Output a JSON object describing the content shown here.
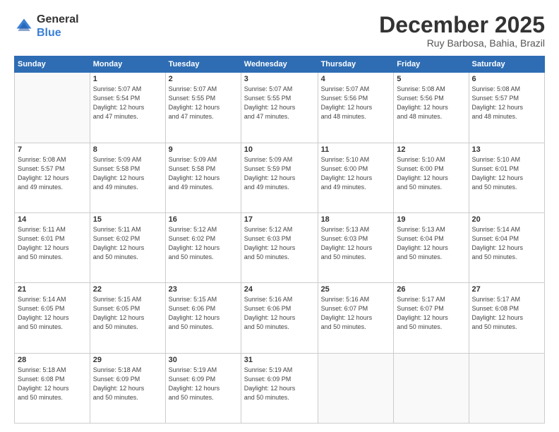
{
  "header": {
    "logo_line1": "General",
    "logo_line2": "Blue",
    "month": "December 2025",
    "location": "Ruy Barbosa, Bahia, Brazil"
  },
  "days_of_week": [
    "Sunday",
    "Monday",
    "Tuesday",
    "Wednesday",
    "Thursday",
    "Friday",
    "Saturday"
  ],
  "weeks": [
    [
      {
        "day": "",
        "info": ""
      },
      {
        "day": "1",
        "info": "Sunrise: 5:07 AM\nSunset: 5:54 PM\nDaylight: 12 hours\nand 47 minutes."
      },
      {
        "day": "2",
        "info": "Sunrise: 5:07 AM\nSunset: 5:55 PM\nDaylight: 12 hours\nand 47 minutes."
      },
      {
        "day": "3",
        "info": "Sunrise: 5:07 AM\nSunset: 5:55 PM\nDaylight: 12 hours\nand 47 minutes."
      },
      {
        "day": "4",
        "info": "Sunrise: 5:07 AM\nSunset: 5:56 PM\nDaylight: 12 hours\nand 48 minutes."
      },
      {
        "day": "5",
        "info": "Sunrise: 5:08 AM\nSunset: 5:56 PM\nDaylight: 12 hours\nand 48 minutes."
      },
      {
        "day": "6",
        "info": "Sunrise: 5:08 AM\nSunset: 5:57 PM\nDaylight: 12 hours\nand 48 minutes."
      }
    ],
    [
      {
        "day": "7",
        "info": "Sunrise: 5:08 AM\nSunset: 5:57 PM\nDaylight: 12 hours\nand 49 minutes."
      },
      {
        "day": "8",
        "info": "Sunrise: 5:09 AM\nSunset: 5:58 PM\nDaylight: 12 hours\nand 49 minutes."
      },
      {
        "day": "9",
        "info": "Sunrise: 5:09 AM\nSunset: 5:58 PM\nDaylight: 12 hours\nand 49 minutes."
      },
      {
        "day": "10",
        "info": "Sunrise: 5:09 AM\nSunset: 5:59 PM\nDaylight: 12 hours\nand 49 minutes."
      },
      {
        "day": "11",
        "info": "Sunrise: 5:10 AM\nSunset: 6:00 PM\nDaylight: 12 hours\nand 49 minutes."
      },
      {
        "day": "12",
        "info": "Sunrise: 5:10 AM\nSunset: 6:00 PM\nDaylight: 12 hours\nand 50 minutes."
      },
      {
        "day": "13",
        "info": "Sunrise: 5:10 AM\nSunset: 6:01 PM\nDaylight: 12 hours\nand 50 minutes."
      }
    ],
    [
      {
        "day": "14",
        "info": "Sunrise: 5:11 AM\nSunset: 6:01 PM\nDaylight: 12 hours\nand 50 minutes."
      },
      {
        "day": "15",
        "info": "Sunrise: 5:11 AM\nSunset: 6:02 PM\nDaylight: 12 hours\nand 50 minutes."
      },
      {
        "day": "16",
        "info": "Sunrise: 5:12 AM\nSunset: 6:02 PM\nDaylight: 12 hours\nand 50 minutes."
      },
      {
        "day": "17",
        "info": "Sunrise: 5:12 AM\nSunset: 6:03 PM\nDaylight: 12 hours\nand 50 minutes."
      },
      {
        "day": "18",
        "info": "Sunrise: 5:13 AM\nSunset: 6:03 PM\nDaylight: 12 hours\nand 50 minutes."
      },
      {
        "day": "19",
        "info": "Sunrise: 5:13 AM\nSunset: 6:04 PM\nDaylight: 12 hours\nand 50 minutes."
      },
      {
        "day": "20",
        "info": "Sunrise: 5:14 AM\nSunset: 6:04 PM\nDaylight: 12 hours\nand 50 minutes."
      }
    ],
    [
      {
        "day": "21",
        "info": "Sunrise: 5:14 AM\nSunset: 6:05 PM\nDaylight: 12 hours\nand 50 minutes."
      },
      {
        "day": "22",
        "info": "Sunrise: 5:15 AM\nSunset: 6:05 PM\nDaylight: 12 hours\nand 50 minutes."
      },
      {
        "day": "23",
        "info": "Sunrise: 5:15 AM\nSunset: 6:06 PM\nDaylight: 12 hours\nand 50 minutes."
      },
      {
        "day": "24",
        "info": "Sunrise: 5:16 AM\nSunset: 6:06 PM\nDaylight: 12 hours\nand 50 minutes."
      },
      {
        "day": "25",
        "info": "Sunrise: 5:16 AM\nSunset: 6:07 PM\nDaylight: 12 hours\nand 50 minutes."
      },
      {
        "day": "26",
        "info": "Sunrise: 5:17 AM\nSunset: 6:07 PM\nDaylight: 12 hours\nand 50 minutes."
      },
      {
        "day": "27",
        "info": "Sunrise: 5:17 AM\nSunset: 6:08 PM\nDaylight: 12 hours\nand 50 minutes."
      }
    ],
    [
      {
        "day": "28",
        "info": "Sunrise: 5:18 AM\nSunset: 6:08 PM\nDaylight: 12 hours\nand 50 minutes."
      },
      {
        "day": "29",
        "info": "Sunrise: 5:18 AM\nSunset: 6:09 PM\nDaylight: 12 hours\nand 50 minutes."
      },
      {
        "day": "30",
        "info": "Sunrise: 5:19 AM\nSunset: 6:09 PM\nDaylight: 12 hours\nand 50 minutes."
      },
      {
        "day": "31",
        "info": "Sunrise: 5:19 AM\nSunset: 6:09 PM\nDaylight: 12 hours\nand 50 minutes."
      },
      {
        "day": "",
        "info": ""
      },
      {
        "day": "",
        "info": ""
      },
      {
        "day": "",
        "info": ""
      }
    ]
  ]
}
